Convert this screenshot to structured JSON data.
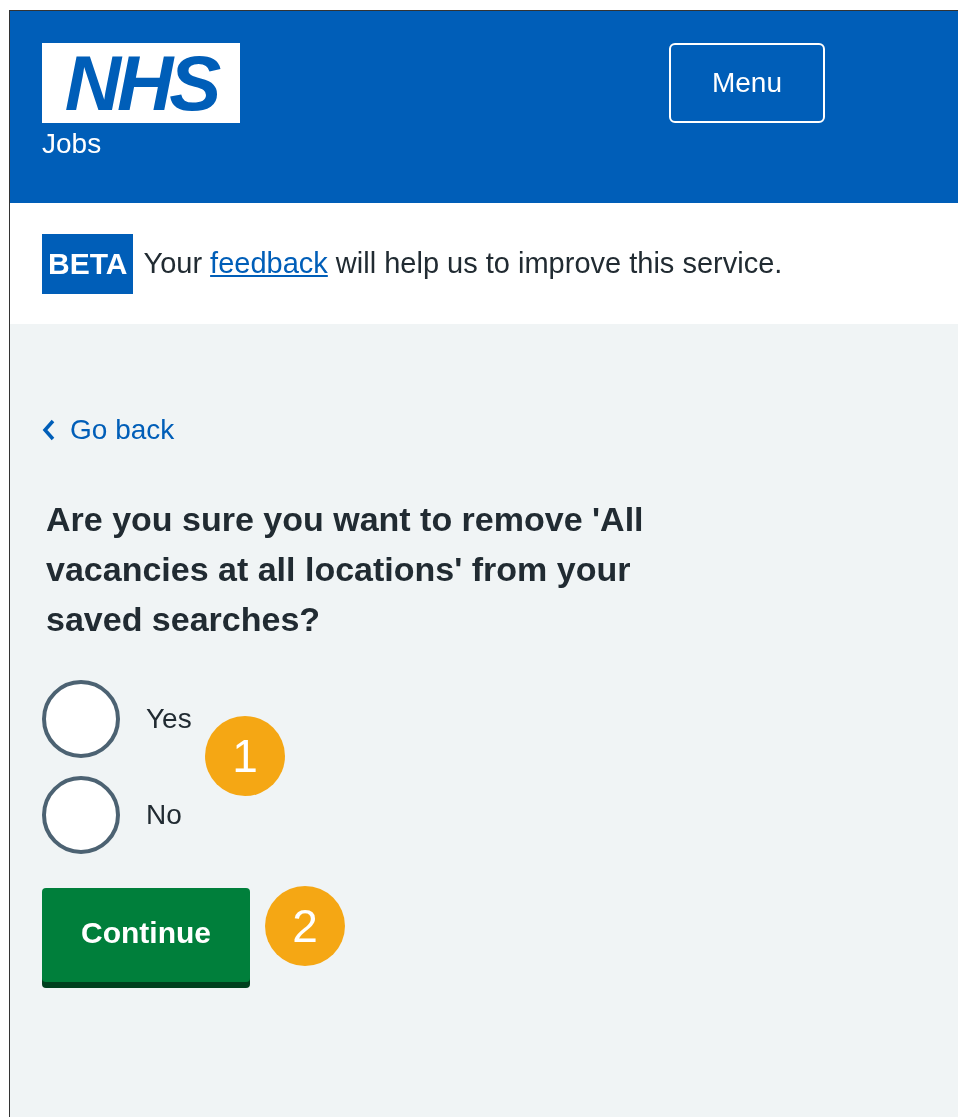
{
  "header": {
    "logo": "NHS",
    "service": "Jobs",
    "menu_button": "Menu"
  },
  "beta_banner": {
    "tag": "BETA",
    "text_before": "Your",
    "link": "feedback",
    "text_after": "will help us to improve this service."
  },
  "back_link": "Go back",
  "question": "Are you sure you want to remove 'All vacancies at all locations' from your saved searches?",
  "options": [
    {
      "label": "Yes",
      "selected": false
    },
    {
      "label": "No",
      "selected": false
    }
  ],
  "continue_button": "Continue",
  "callouts": [
    {
      "number": "1"
    },
    {
      "number": "2"
    }
  ]
}
